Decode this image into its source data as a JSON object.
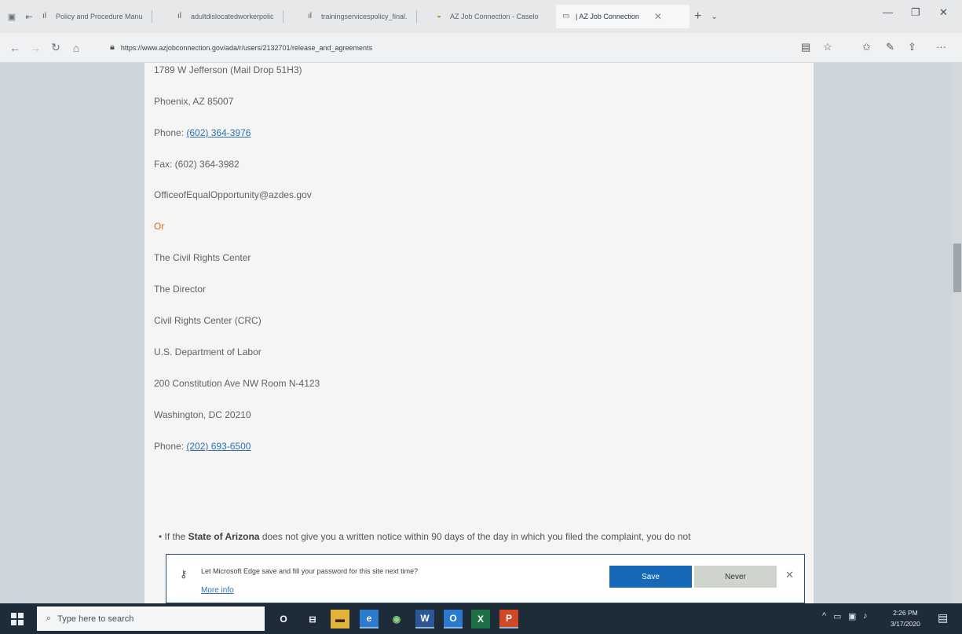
{
  "browser": {
    "tabs": [
      {
        "label": "Policy and Procedure Manu",
        "icon": "chart-bar-icon"
      },
      {
        "label": "adultdislocatedworkerpolic",
        "icon": "chart-bar-icon"
      },
      {
        "label": "trainingservicespolicy_final.",
        "icon": "chart-bar-icon"
      },
      {
        "label": "AZ Job Connection - Caselo",
        "icon": "az-logo-icon"
      },
      {
        "label": "| AZ Job Connection",
        "icon": "page-icon"
      }
    ],
    "url": "https://www.azjobconnection.gov/ada/r/users/2132701/release_and_agreements"
  },
  "content": {
    "address": "1789 W Jefferson (Mail Drop 51H3)",
    "city": "Phoenix, AZ 85007",
    "phone_label": "Phone:",
    "phone1": "(602) 364-3976",
    "fax": "Fax: (602) 364-3982",
    "email": "OfficeofEqualOpportunity@azdes.gov",
    "or": "Or",
    "crc_name": "The Civil Rights Center",
    "director": "The Director",
    "crc_abbr": "Civil Rights Center (CRC)",
    "department": "U.S. Department of Labor",
    "street": "200 Constitution Ave NW Room N-4123",
    "dc_city": "Washington, DC 20210",
    "phone2": "(202) 693-6500",
    "bullet_prefix": "If the ",
    "bullet_bold": "State of Arizona",
    "bullet_suffix": " does not give you a written notice within 90 days of the day in which you filed the complaint, you do not"
  },
  "password_prompt": {
    "message": "Let Microsoft Edge save and fill your password for this site next time?",
    "more_info": "More info",
    "save_label": "Save",
    "never_label": "Never"
  },
  "taskbar": {
    "search_placeholder": "Type here to search",
    "time": "2:26 PM",
    "date": "3/17/2020"
  }
}
